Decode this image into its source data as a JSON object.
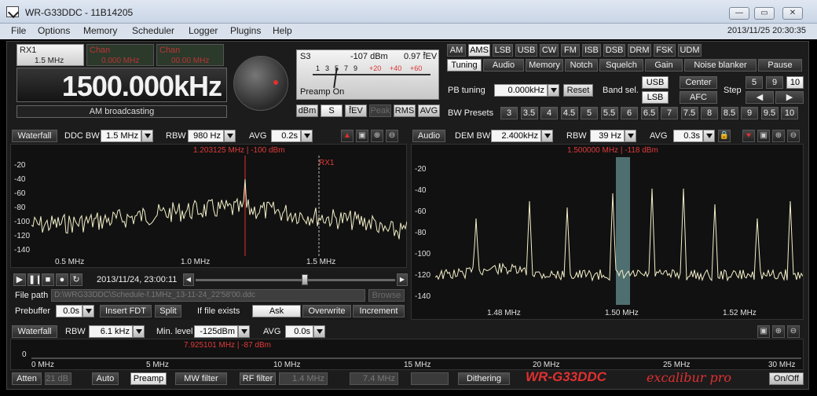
{
  "window": {
    "title": "WR-G33DDC - 11B14205",
    "min": "—",
    "max": "▭",
    "close": "✕"
  },
  "menu": [
    "File",
    "Options",
    "Memory",
    "Scheduler",
    "Logger",
    "Plugins",
    "Help"
  ],
  "datetime": "2013/11/25 20:30:35",
  "receiver": {
    "tabs": [
      "RX1",
      "Chan",
      "Chan"
    ],
    "tab_freqs": [
      "1.5 MHz",
      "0.000 MHz",
      "00.00 MHz"
    ],
    "frequency": "1500.000kHz",
    "station": "AM broadcasting"
  },
  "smeter": {
    "s_label": "S3",
    "dbm": "-107 dBm",
    "fev": "0.97 f̄EV",
    "scale": [
      "1",
      "3",
      "5",
      "7",
      "9",
      "+20",
      "+40",
      "+60"
    ],
    "preamp": "Preamp On",
    "buttons": [
      "dBm",
      "S",
      "f̄EV",
      "Peak",
      "RMS",
      "AVG"
    ]
  },
  "modes": [
    "AM",
    "AMS",
    "LSB",
    "USB",
    "CW",
    "FM",
    "ISB",
    "DSB",
    "DRM",
    "FSK",
    "UDM"
  ],
  "active_mode": "AMS",
  "tabs2": [
    "Tuning",
    "Audio",
    "Memory",
    "Notch",
    "Squelch",
    "Gain",
    "Noise blanker",
    "Pause"
  ],
  "tuning": {
    "pb_label": "PB tuning",
    "pb_value": "0.000kHz",
    "reset": "Reset",
    "band_sel": "Band sel.",
    "usb": "USB",
    "lsb": "LSB",
    "center": "Center",
    "afc": "AFC",
    "step_label": "Step",
    "steps": [
      "5",
      "9",
      "10"
    ],
    "bw_label": "BW Presets",
    "bw_presets": [
      "3",
      "3.5",
      "4",
      "4.5",
      "5",
      "5.5",
      "6",
      "6.5",
      "7",
      "7.5",
      "8",
      "8.5",
      "9",
      "9.5",
      "10"
    ]
  },
  "ddc_spectrum": {
    "mode_btn": "Waterfall",
    "ddc_bw_label": "DDC BW",
    "ddc_bw": "1.5 MHz",
    "rbw_label": "RBW",
    "rbw": "980 Hz",
    "avg_label": "AVG",
    "avg": "0.2s",
    "marker": "1.203125 MHz | -100 dBm",
    "rx_marker": "RX1",
    "y_ticks": [
      "-20",
      "-40",
      "-60",
      "-80",
      "-100",
      "-120",
      "-140"
    ],
    "x_ticks": [
      "0.5 MHz",
      "1.0 MHz",
      "1.5 MHz"
    ]
  },
  "demod_spectrum": {
    "mode_btn": "Audio",
    "dem_bw_label": "DEM BW",
    "dem_bw": "2.400kHz",
    "rbw_label": "RBW",
    "rbw": "39 Hz",
    "avg_label": "AVG",
    "avg": "0.3s",
    "marker": "1.500000 MHz | -118 dBm",
    "y_ticks": [
      "-20",
      "-40",
      "-60",
      "-80",
      "-100",
      "-120",
      "-140"
    ],
    "x_ticks": [
      "1.48 MHz",
      "1.50 MHz",
      "1.52 MHz"
    ]
  },
  "recorder": {
    "timestamp": "2013/11/24, 23:00:11",
    "file_label": "File path",
    "file_path": "D:\\WRG33DDC\\Schedule-f.1MHz_13-11-24_22'58'00.ddc",
    "browse": "Browse",
    "prebuffer_label": "Prebuffer",
    "prebuffer": "0.0s",
    "insert_fdt": "Insert FDT",
    "split": "Split",
    "if_exists": "If file exists",
    "ask": "Ask",
    "overwrite": "Overwrite",
    "increment": "Increment"
  },
  "wideband": {
    "mode_btn": "Waterfall",
    "rbw_label": "RBW",
    "rbw": "6.1 kHz",
    "min_level_label": "Min. level",
    "min_level": "-125dBm",
    "avg_label": "AVG",
    "avg": "0.0s",
    "marker": "7.925101 MHz | -87 dBm",
    "y_tick": "0",
    "x_ticks": [
      "0 MHz",
      "5 MHz",
      "10 MHz",
      "15 MHz",
      "20 MHz",
      "25 MHz",
      "30 MHz"
    ]
  },
  "bottom": {
    "atten": "Atten",
    "atten_val": "21 dB",
    "auto": "Auto",
    "preamp": "Preamp",
    "mw_filter": "MW filter",
    "rf_filter": "RF filter",
    "rf_lo": "1.4 MHz",
    "rf_hi": "7.4 MHz",
    "dithering": "Dithering",
    "brand": "WR-G33DDC",
    "edition": "excalibur pro",
    "onoff": "On/Off"
  },
  "colors": {
    "accent": "#e03030",
    "trace": "#f4f0c8",
    "bg": "#111111"
  }
}
